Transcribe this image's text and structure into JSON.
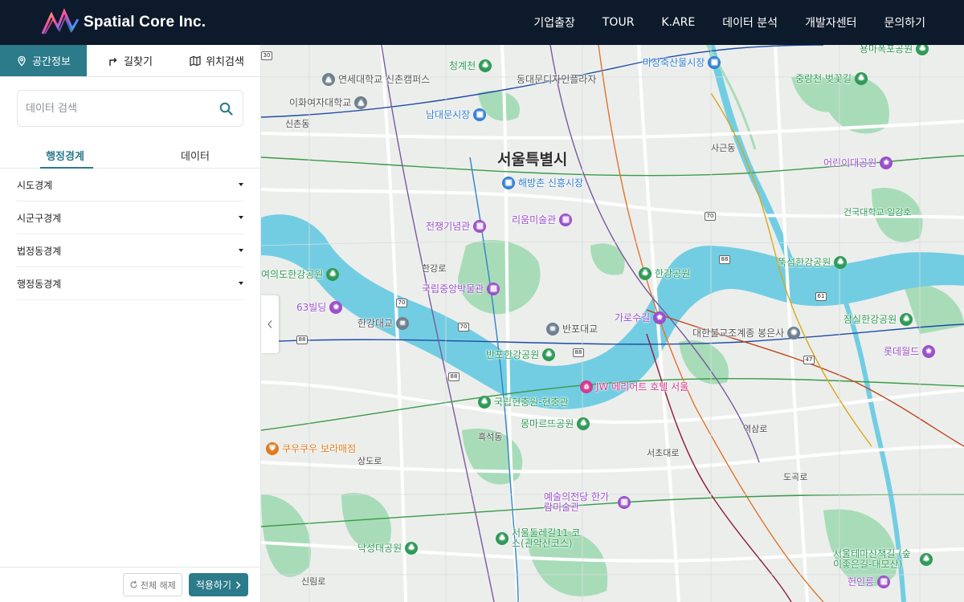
{
  "header": {
    "brand": "Spatial Core Inc.",
    "nav": [
      "기업출장",
      "TOUR",
      "K.ARE",
      "데이터 분석",
      "개발자센터",
      "문의하기"
    ]
  },
  "sidebar": {
    "tabs": [
      {
        "label": "공간정보",
        "icon": "pin-icon",
        "active": true
      },
      {
        "label": "길찾기",
        "icon": "route-arrow-icon",
        "active": false
      },
      {
        "label": "위치검색",
        "icon": "map-icon",
        "active": false
      }
    ],
    "search": {
      "placeholder": "데이터 검색",
      "value": ""
    },
    "subtabs": [
      {
        "label": "행정경계",
        "active": true
      },
      {
        "label": "데이터",
        "active": false
      }
    ],
    "layers": [
      "시도경계",
      "시군구경계",
      "법정동경계",
      "행정동경계"
    ],
    "reset_label": "전체 해제",
    "apply_label": "적용하기"
  },
  "map": {
    "city_label": "서울특별시",
    "colors": {
      "river": "#72cde3",
      "park": "#9ed9b0",
      "road": "#ffffff",
      "land": "#eceeec"
    },
    "pois": [
      {
        "name": "연세대학교 신촌캠퍼스",
        "type": "school",
        "color": "#6f7f8f"
      },
      {
        "name": "이화여자대학교",
        "type": "school",
        "color": "#6f7f8f"
      },
      {
        "name": "청계천",
        "type": "park",
        "color": "#2f9a57"
      },
      {
        "name": "동대문디자인플라자",
        "type": "landmark",
        "color": "#7b4bb4"
      },
      {
        "name": "마장축산물시장",
        "type": "market",
        "color": "#2f7fd6"
      },
      {
        "name": "용마폭포공원",
        "type": "park",
        "color": "#2f9a57"
      },
      {
        "name": "중랑천 벚꽃길",
        "type": "park",
        "color": "#2f9a57"
      },
      {
        "name": "남대문시장",
        "type": "market",
        "color": "#2f7fd6"
      },
      {
        "name": "해방촌 신흥시장",
        "type": "market",
        "color": "#2f7fd6"
      },
      {
        "name": "어린이대공원",
        "type": "park",
        "color": "#9b4fc9"
      },
      {
        "name": "전쟁기념관",
        "type": "museum",
        "color": "#9b4fc9"
      },
      {
        "name": "리움미술관",
        "type": "museum",
        "color": "#9b4fc9"
      },
      {
        "name": "건국대학교 일감호",
        "type": "label",
        "color": "#2f9a57"
      },
      {
        "name": "뚝섬한강공원",
        "type": "park",
        "color": "#2f9a57"
      },
      {
        "name": "국립중앙박물관",
        "type": "museum",
        "color": "#9b4fc9"
      },
      {
        "name": "한강공원",
        "type": "park",
        "color": "#2f9a57"
      },
      {
        "name": "여의도한강공원",
        "type": "park",
        "color": "#2f9a57"
      },
      {
        "name": "63빌딩",
        "type": "landmark",
        "color": "#9b4fc9"
      },
      {
        "name": "한강대교",
        "type": "bridge",
        "color": "#6f7f8f"
      },
      {
        "name": "반포대교",
        "type": "bridge",
        "color": "#6f7f8f"
      },
      {
        "name": "가로수길",
        "type": "landmark",
        "color": "#9b4fc9"
      },
      {
        "name": "대한불교조계종 봉은사",
        "type": "temple",
        "color": "#6f7f8f"
      },
      {
        "name": "잠실한강공원",
        "type": "park",
        "color": "#2f9a57"
      },
      {
        "name": "롯데월드",
        "type": "landmark",
        "color": "#9b4fc9"
      },
      {
        "name": "반포한강공원",
        "type": "park",
        "color": "#2f9a57"
      },
      {
        "name": "JW 메리어트 호텔 서울",
        "type": "hotel",
        "color": "#d23b8f"
      },
      {
        "name": "국립현충원-현충관",
        "type": "park",
        "color": "#2f9a57"
      },
      {
        "name": "몽마르뜨공원",
        "type": "park",
        "color": "#2f9a57"
      },
      {
        "name": "쿠우쿠우 보라매점",
        "type": "restaurant",
        "color": "#e07a1f"
      },
      {
        "name": "예술의전당 한가람미술관",
        "type": "museum",
        "color": "#9b4fc9"
      },
      {
        "name": "서울둘레길11 코스(관악산코스)",
        "type": "park",
        "color": "#2f9a57"
      },
      {
        "name": "낙성대공원",
        "type": "park",
        "color": "#2f9a57"
      },
      {
        "name": "서울테마산책길 (숲이좋은길-대모산)",
        "type": "park",
        "color": "#2f9a57"
      },
      {
        "name": "헌인릉",
        "type": "heritage",
        "color": "#9b4fc9"
      }
    ]
  }
}
